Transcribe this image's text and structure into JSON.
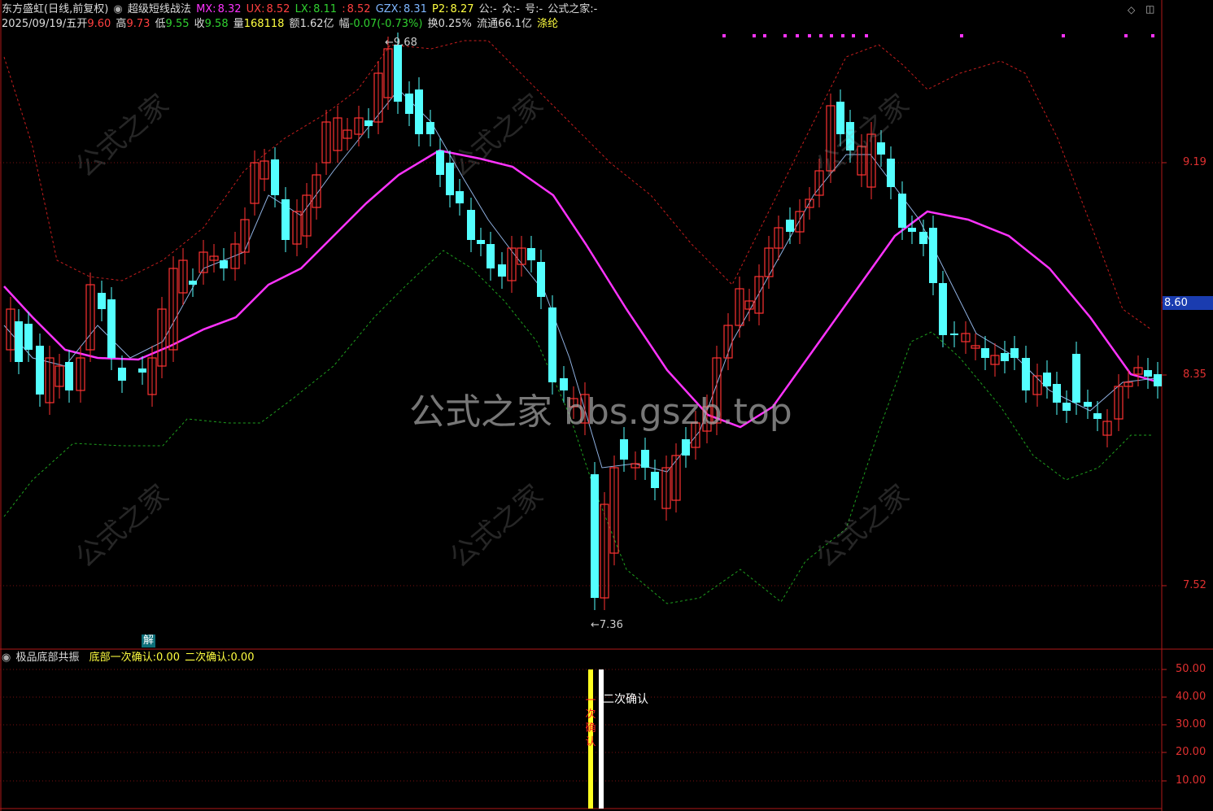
{
  "header": {
    "stock": "东方盛虹(日线,前复权)",
    "indicator": "超级短线战法",
    "mx_label": "MX:",
    "mx": "8.32",
    "ux_label": "UX:",
    "ux": "8.52",
    "lx_label": "LX:",
    "lx": "8.11",
    "colon_label": ":",
    "colon_val": "8.52",
    "gzx_label": "GZX:",
    "gzx": "8.31",
    "p2_label": "P2:",
    "p2": "8.27",
    "gong": "公:-",
    "zhong": "众:-",
    "hao": "号:-",
    "site": "公式之家:-"
  },
  "quote": {
    "date": "2025/09/19/五",
    "open_l": "开",
    "open": "9.60",
    "high_l": "高",
    "high": "9.73",
    "low_l": "低",
    "low": "9.55",
    "close_l": "收",
    "close": "9.58",
    "vol_l": "量",
    "vol": "168118",
    "amt_l": "额",
    "amt": "1.62亿",
    "chg_l": "幅",
    "chg": "-0.07(-0.73%)",
    "turn_l": "换",
    "turn": "0.25%",
    "float_l": "流通",
    "float": "66.1亿",
    "tag": "涤纶"
  },
  "price_axis": {
    "t1": "9.19",
    "t2": "8.60",
    "t3": "8.35",
    "t4": "7.52"
  },
  "annotations": {
    "high_mark": "9.68",
    "low_mark": "7.36",
    "jie": "解",
    "watermark": "公式之家 bbs.gszb.top",
    "wm_small": "公式之家"
  },
  "sub": {
    "title": "极品底部共振",
    "l1": "底部一次确认:",
    "v1": "0.00",
    "l2": "二次确认:",
    "v2": "0.00",
    "confirm_text": "二次确认",
    "yticks": [
      "50.00",
      "40.00",
      "30.00",
      "20.00",
      "10.00"
    ]
  },
  "colors": {
    "up": "#ff3232",
    "down": "#54ffff",
    "ma": "#ff33ff",
    "upper": "#c81e1e",
    "lower": "#1ea01e"
  }
}
